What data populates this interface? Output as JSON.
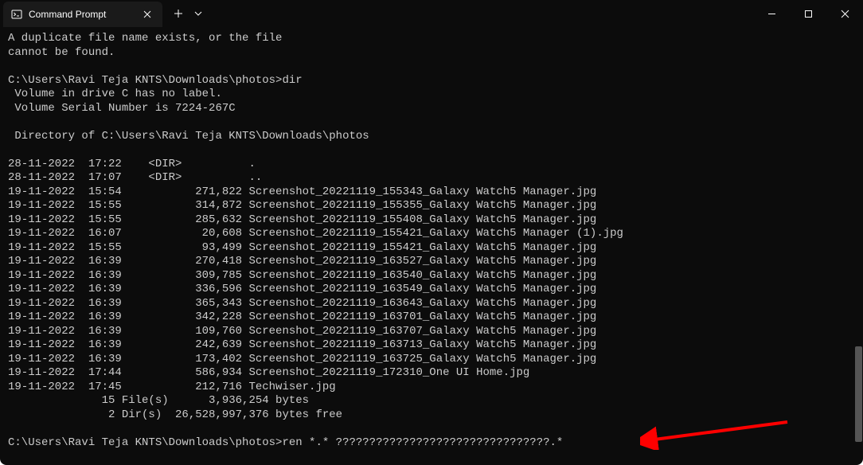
{
  "tab": {
    "title": "Command Prompt"
  },
  "terminal": {
    "lines": [
      "A duplicate file name exists, or the file",
      "cannot be found.",
      "",
      "C:\\Users\\Ravi Teja KNTS\\Downloads\\photos>dir",
      " Volume in drive C has no label.",
      " Volume Serial Number is 7224-267C",
      "",
      " Directory of C:\\Users\\Ravi Teja KNTS\\Downloads\\photos",
      "",
      "28-11-2022  17:22    <DIR>          .",
      "28-11-2022  17:07    <DIR>          ..",
      "19-11-2022  15:54           271,822 Screenshot_20221119_155343_Galaxy Watch5 Manager.jpg",
      "19-11-2022  15:55           314,872 Screenshot_20221119_155355_Galaxy Watch5 Manager.jpg",
      "19-11-2022  15:55           285,632 Screenshot_20221119_155408_Galaxy Watch5 Manager.jpg",
      "19-11-2022  16:07            20,608 Screenshot_20221119_155421_Galaxy Watch5 Manager (1).jpg",
      "19-11-2022  15:55            93,499 Screenshot_20221119_155421_Galaxy Watch5 Manager.jpg",
      "19-11-2022  16:39           270,418 Screenshot_20221119_163527_Galaxy Watch5 Manager.jpg",
      "19-11-2022  16:39           309,785 Screenshot_20221119_163540_Galaxy Watch5 Manager.jpg",
      "19-11-2022  16:39           336,596 Screenshot_20221119_163549_Galaxy Watch5 Manager.jpg",
      "19-11-2022  16:39           365,343 Screenshot_20221119_163643_Galaxy Watch5 Manager.jpg",
      "19-11-2022  16:39           342,228 Screenshot_20221119_163701_Galaxy Watch5 Manager.jpg",
      "19-11-2022  16:39           109,760 Screenshot_20221119_163707_Galaxy Watch5 Manager.jpg",
      "19-11-2022  16:39           242,639 Screenshot_20221119_163713_Galaxy Watch5 Manager.jpg",
      "19-11-2022  16:39           173,402 Screenshot_20221119_163725_Galaxy Watch5 Manager.jpg",
      "19-11-2022  17:44           586,934 Screenshot_20221119_172310_One UI Home.jpg",
      "19-11-2022  17:45           212,716 Techwiser.jpg",
      "              15 File(s)      3,936,254 bytes",
      "               2 Dir(s)  26,528,997,376 bytes free",
      "",
      "C:\\Users\\Ravi Teja KNTS\\Downloads\\photos>ren *.* ????????????????????????????????.*"
    ]
  }
}
